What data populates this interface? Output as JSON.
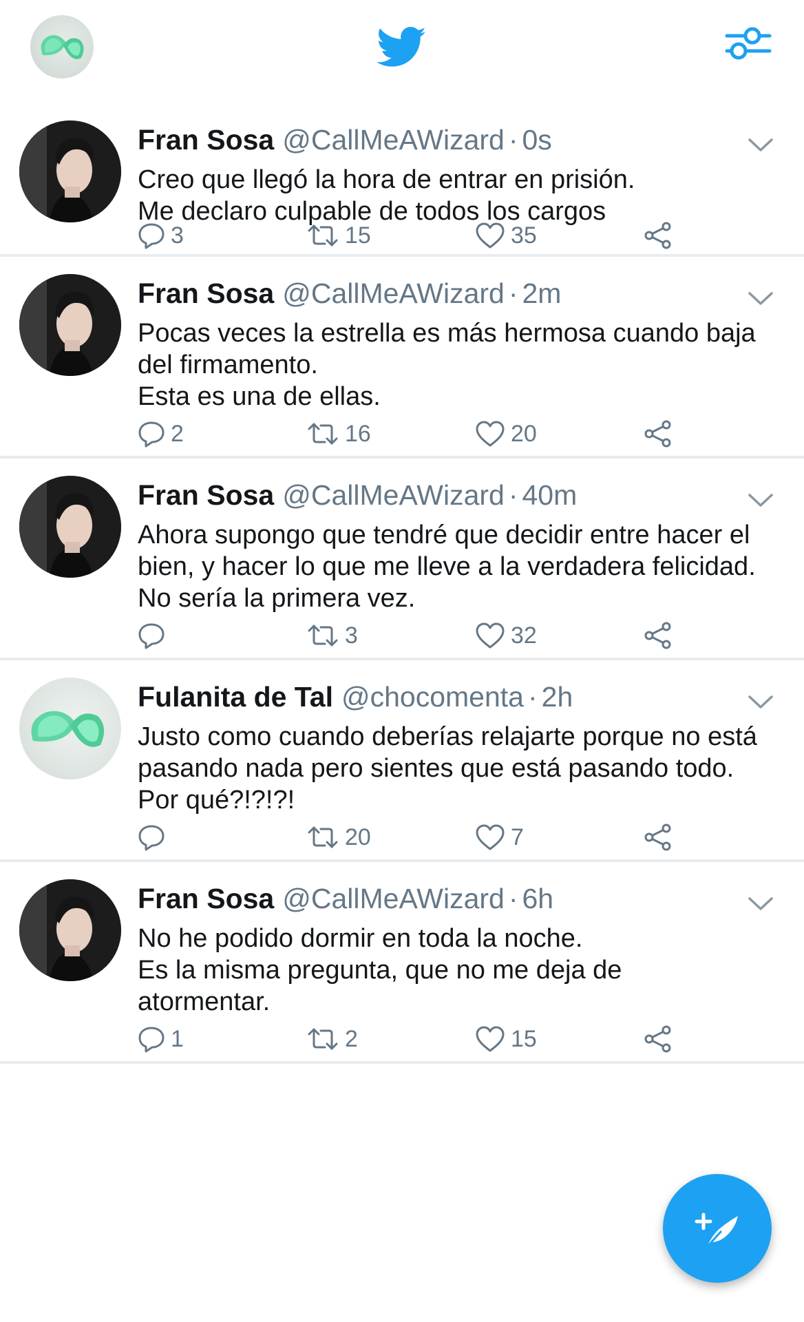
{
  "colors": {
    "accent": "#1da1f2",
    "secondary_text": "#657786",
    "divider": "#e6ecf0"
  },
  "tweets": [
    {
      "name": "Fran Sosa",
      "handle": "@CallMeAWizard",
      "time": "0s",
      "avatar": "person",
      "lines": [
        "Creo que llegó la hora de entrar en prisión.",
        "Me declaro culpable de todos los cargos"
      ],
      "replies": "3",
      "retweets": "15",
      "likes": "35"
    },
    {
      "name": "Fran Sosa",
      "handle": "@CallMeAWizard",
      "time": "2m",
      "avatar": "person",
      "lines": [
        "Pocas veces la estrella es más hermosa cuando baja",
        "del firmamento.",
        "Esta es una de ellas."
      ],
      "replies": "2",
      "retweets": "16",
      "likes": "20"
    },
    {
      "name": "Fran Sosa",
      "handle": "@CallMeAWizard",
      "time": "40m",
      "avatar": "person",
      "lines": [
        "Ahora supongo que tendré que decidir entre hacer el",
        "bien, y hacer lo que me lleve a la verdadera felicidad.",
        "No sería la primera vez."
      ],
      "replies": "",
      "retweets": "3",
      "likes": "32"
    },
    {
      "name": "Fulanita de Tal",
      "handle": "@chocomenta",
      "time": "2h",
      "avatar": "lime",
      "lines": [
        "Justo como cuando deberías relajarte porque no está",
        "pasando nada pero sientes que está pasando todo.",
        "Por qué?!?!?!"
      ],
      "replies": "",
      "retweets": "20",
      "likes": "7"
    },
    {
      "name": "Fran Sosa",
      "handle": "@CallMeAWizard",
      "time": "6h",
      "avatar": "person",
      "lines": [
        "No he podido dormir en toda la noche.",
        "Es la misma pregunta, que no me deja de",
        "atormentar."
      ],
      "replies": "1",
      "retweets": "2",
      "likes": "15"
    }
  ]
}
